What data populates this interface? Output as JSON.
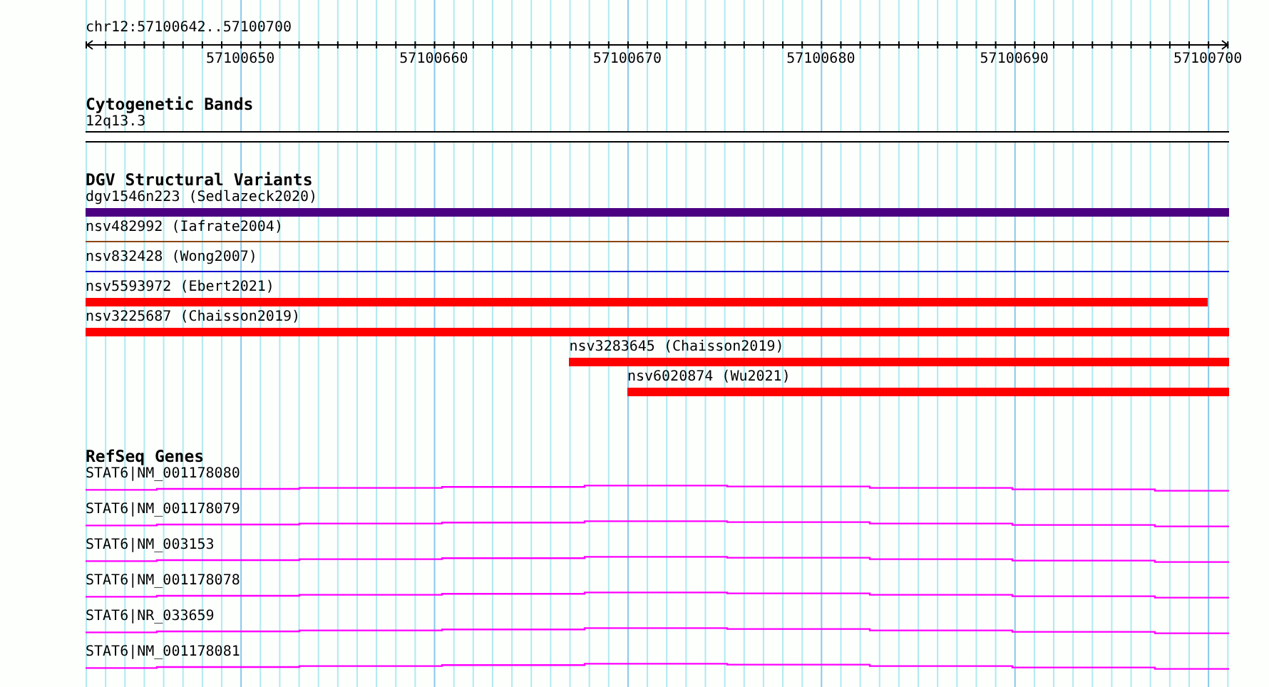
{
  "region": "chr12:57100642..57100700",
  "axis": {
    "tick_labels": [
      "57100650",
      "57100660",
      "57100670",
      "57100680",
      "57100690",
      "57100700"
    ]
  },
  "tracks": [
    {
      "kind": "bands",
      "title": "Cytogenetic Bands",
      "features": [
        {
          "label": "12q13.3"
        }
      ]
    },
    {
      "kind": "variants",
      "title": "DGV Structural Variants",
      "features": [
        {
          "label": "dgv1546n223 (Sedlazeck2020)",
          "kind": "bar",
          "color": "#4b0082"
        },
        {
          "label": "nsv482992 (Iafrate2004)",
          "kind": "line",
          "color": "#8b4513"
        },
        {
          "label": "nsv832428 (Wong2007)",
          "kind": "line",
          "color": "#0000cd"
        },
        {
          "label": "nsv5593972 (Ebert2021)",
          "kind": "bar",
          "color": "#ff0000"
        },
        {
          "label": "nsv3225687 (Chaisson2019)",
          "kind": "bar",
          "color": "#ff0000"
        },
        {
          "label": "nsv3283645 (Chaisson2019)",
          "kind": "bar",
          "color": "#ff0000"
        },
        {
          "label": "nsv6020874 (Wu2021)",
          "kind": "bar",
          "color": "#ff0000"
        }
      ]
    },
    {
      "kind": "genes",
      "title": "RefSeq Genes",
      "features": [
        {
          "label": "STAT6|NM_001178080"
        },
        {
          "label": "STAT6|NM_001178079"
        },
        {
          "label": "STAT6|NM_003153"
        },
        {
          "label": "STAT6|NM_001178078"
        },
        {
          "label": "STAT6|NR_033659"
        },
        {
          "label": "STAT6|NM_001178081"
        }
      ]
    }
  ]
}
